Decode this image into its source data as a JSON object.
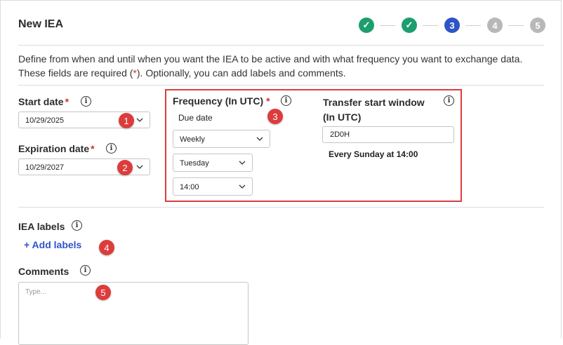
{
  "header": {
    "title": "New IEA"
  },
  "stepper": [
    {
      "label": "✓",
      "state": "done"
    },
    {
      "label": "✓",
      "state": "done"
    },
    {
      "label": "3",
      "state": "active"
    },
    {
      "label": "4",
      "state": "todo"
    },
    {
      "label": "5",
      "state": "todo"
    }
  ],
  "description": {
    "part1": "Define from when and until when you want the IEA to be active and with what frequency you want to exchange data. These fields are required (",
    "asterisk": "*",
    "part2": "). Optionally, you can add labels and comments."
  },
  "start_date": {
    "label": "Start date",
    "required": "*",
    "value": "10/29/2025"
  },
  "expiration_date": {
    "label": "Expiration date",
    "required": "*",
    "value": "10/29/2027"
  },
  "frequency": {
    "label": "Frequency (In UTC)",
    "required": "*",
    "due_date_label": "Due date",
    "period": "Weekly",
    "day": "Tuesday",
    "time": "14:00"
  },
  "transfer_window": {
    "label_line1": "Transfer start window",
    "label_line2": "(In UTC)",
    "value": "2D0H",
    "summary": "Every Sunday at 14:00"
  },
  "iea_labels": {
    "label": "IEA labels",
    "add_link": "+ Add labels"
  },
  "comments": {
    "label": "Comments",
    "placeholder": "Type..."
  },
  "annotations": [
    "1",
    "2",
    "3",
    "4",
    "5"
  ],
  "colors": {
    "accent": "#2f54c8",
    "done": "#1e9e6e",
    "todo": "#b8b8b8",
    "annotation": "#dd3c3c"
  }
}
